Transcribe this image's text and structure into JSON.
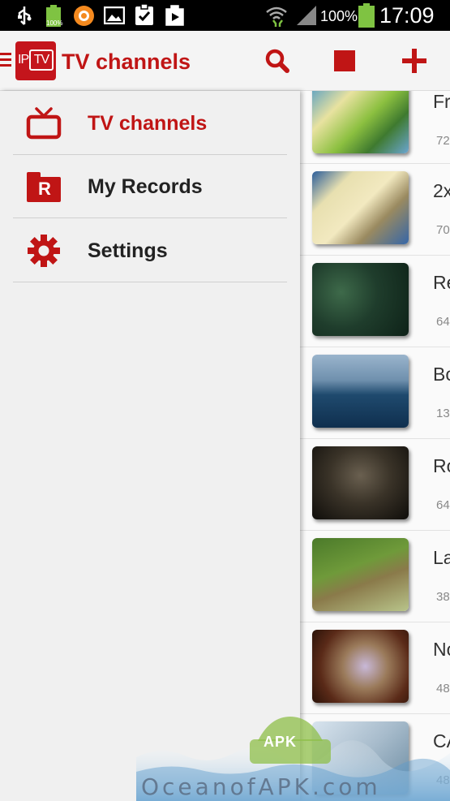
{
  "status_bar": {
    "battery_percent": "100%",
    "time": "17:09",
    "small_battery_label": "100%",
    "icons": [
      "usb-icon",
      "battery-icon",
      "app-notification-icon",
      "image-icon",
      "clipboard-check-icon",
      "play-store-icon",
      "wifi-icon",
      "signal-icon",
      "battery-full-icon"
    ]
  },
  "action_bar": {
    "logo_ip": "IP",
    "logo_tv": "TV",
    "title": "TV channels",
    "actions": [
      "search-icon",
      "stop-icon",
      "add-icon"
    ]
  },
  "drawer": {
    "items": [
      {
        "label": "TV channels",
        "icon": "tv-icon",
        "active": true
      },
      {
        "label": "My Records",
        "icon": "records-folder-icon",
        "icon_letter": "R",
        "active": false
      },
      {
        "label": "Settings",
        "icon": "gear-icon",
        "active": false
      }
    ]
  },
  "channels": [
    {
      "name": "Fr",
      "count": "72"
    },
    {
      "name": "2x",
      "count": "70"
    },
    {
      "name": "Re",
      "count": "64"
    },
    {
      "name": "Bo",
      "count": "13"
    },
    {
      "name": "Ro",
      "count": "64"
    },
    {
      "name": "La",
      "count": "38"
    },
    {
      "name": "No",
      "count": "48"
    },
    {
      "name": "CA",
      "count": "48"
    }
  ],
  "watermark": {
    "text": "OceanofAPK.com",
    "badge": "APK"
  },
  "colors": {
    "accent": "#c01515",
    "status_bar": "#000000",
    "drawer_bg": "#f0f0f0"
  }
}
